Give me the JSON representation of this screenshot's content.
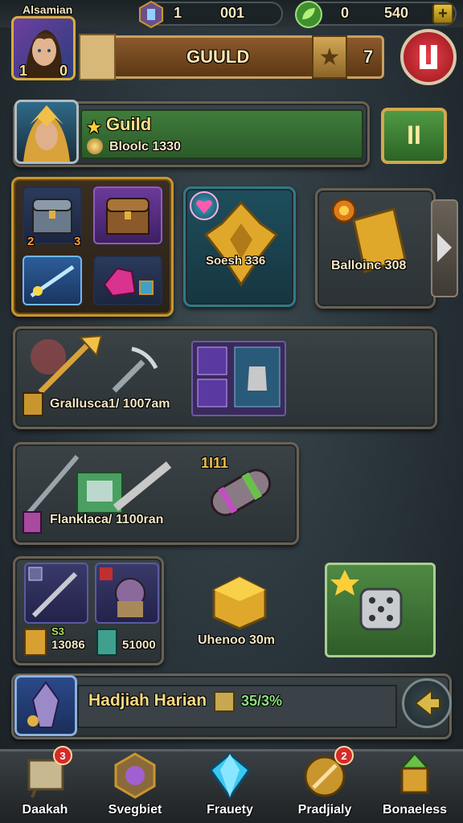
{
  "topbar": {
    "player_name": "Alsamian",
    "level_left": "1",
    "level_right": "0",
    "gem_count": "1",
    "gem_value": "001",
    "energy_count": "0",
    "gold_value": "540",
    "add_symbol": "+"
  },
  "banner": {
    "title": "GUULD",
    "rank": "7"
  },
  "guild": {
    "name": "Guild",
    "star": "★",
    "subtitle": "Bloolc 1330",
    "action_symbol": "II"
  },
  "rewards": {
    "chest_left_count": "2",
    "chest_right_count": "3",
    "shield_label": "Soesh 336",
    "bundle_label": "Balloinc 308"
  },
  "crafting": {
    "label": "Grallusca1/ 1007am"
  },
  "forge": {
    "label": "Flanklaca/ 1100ran",
    "marker": "1I11"
  },
  "shop": {
    "left_value": "13086",
    "right_value": "51000",
    "left_tag": "S3",
    "cube_label": "Uhenoo 30m"
  },
  "hero_bar": {
    "name": "Hadjiah Harian",
    "progress": "35/3%"
  },
  "nav": [
    {
      "label": "Daakah",
      "badge": "3",
      "icon": "board-icon"
    },
    {
      "label": "Svegbiet",
      "badge": "",
      "icon": "orb-icon"
    },
    {
      "label": "Frauety",
      "badge": "",
      "icon": "crystal-icon"
    },
    {
      "label": "Pradjialy",
      "badge": "2",
      "icon": "sword-icon"
    },
    {
      "label": "Bonaeless",
      "badge": "",
      "icon": "tower-icon"
    }
  ],
  "colors": {
    "gold": "#c9962e",
    "green": "#3f7d3a",
    "red": "#c2262e"
  }
}
